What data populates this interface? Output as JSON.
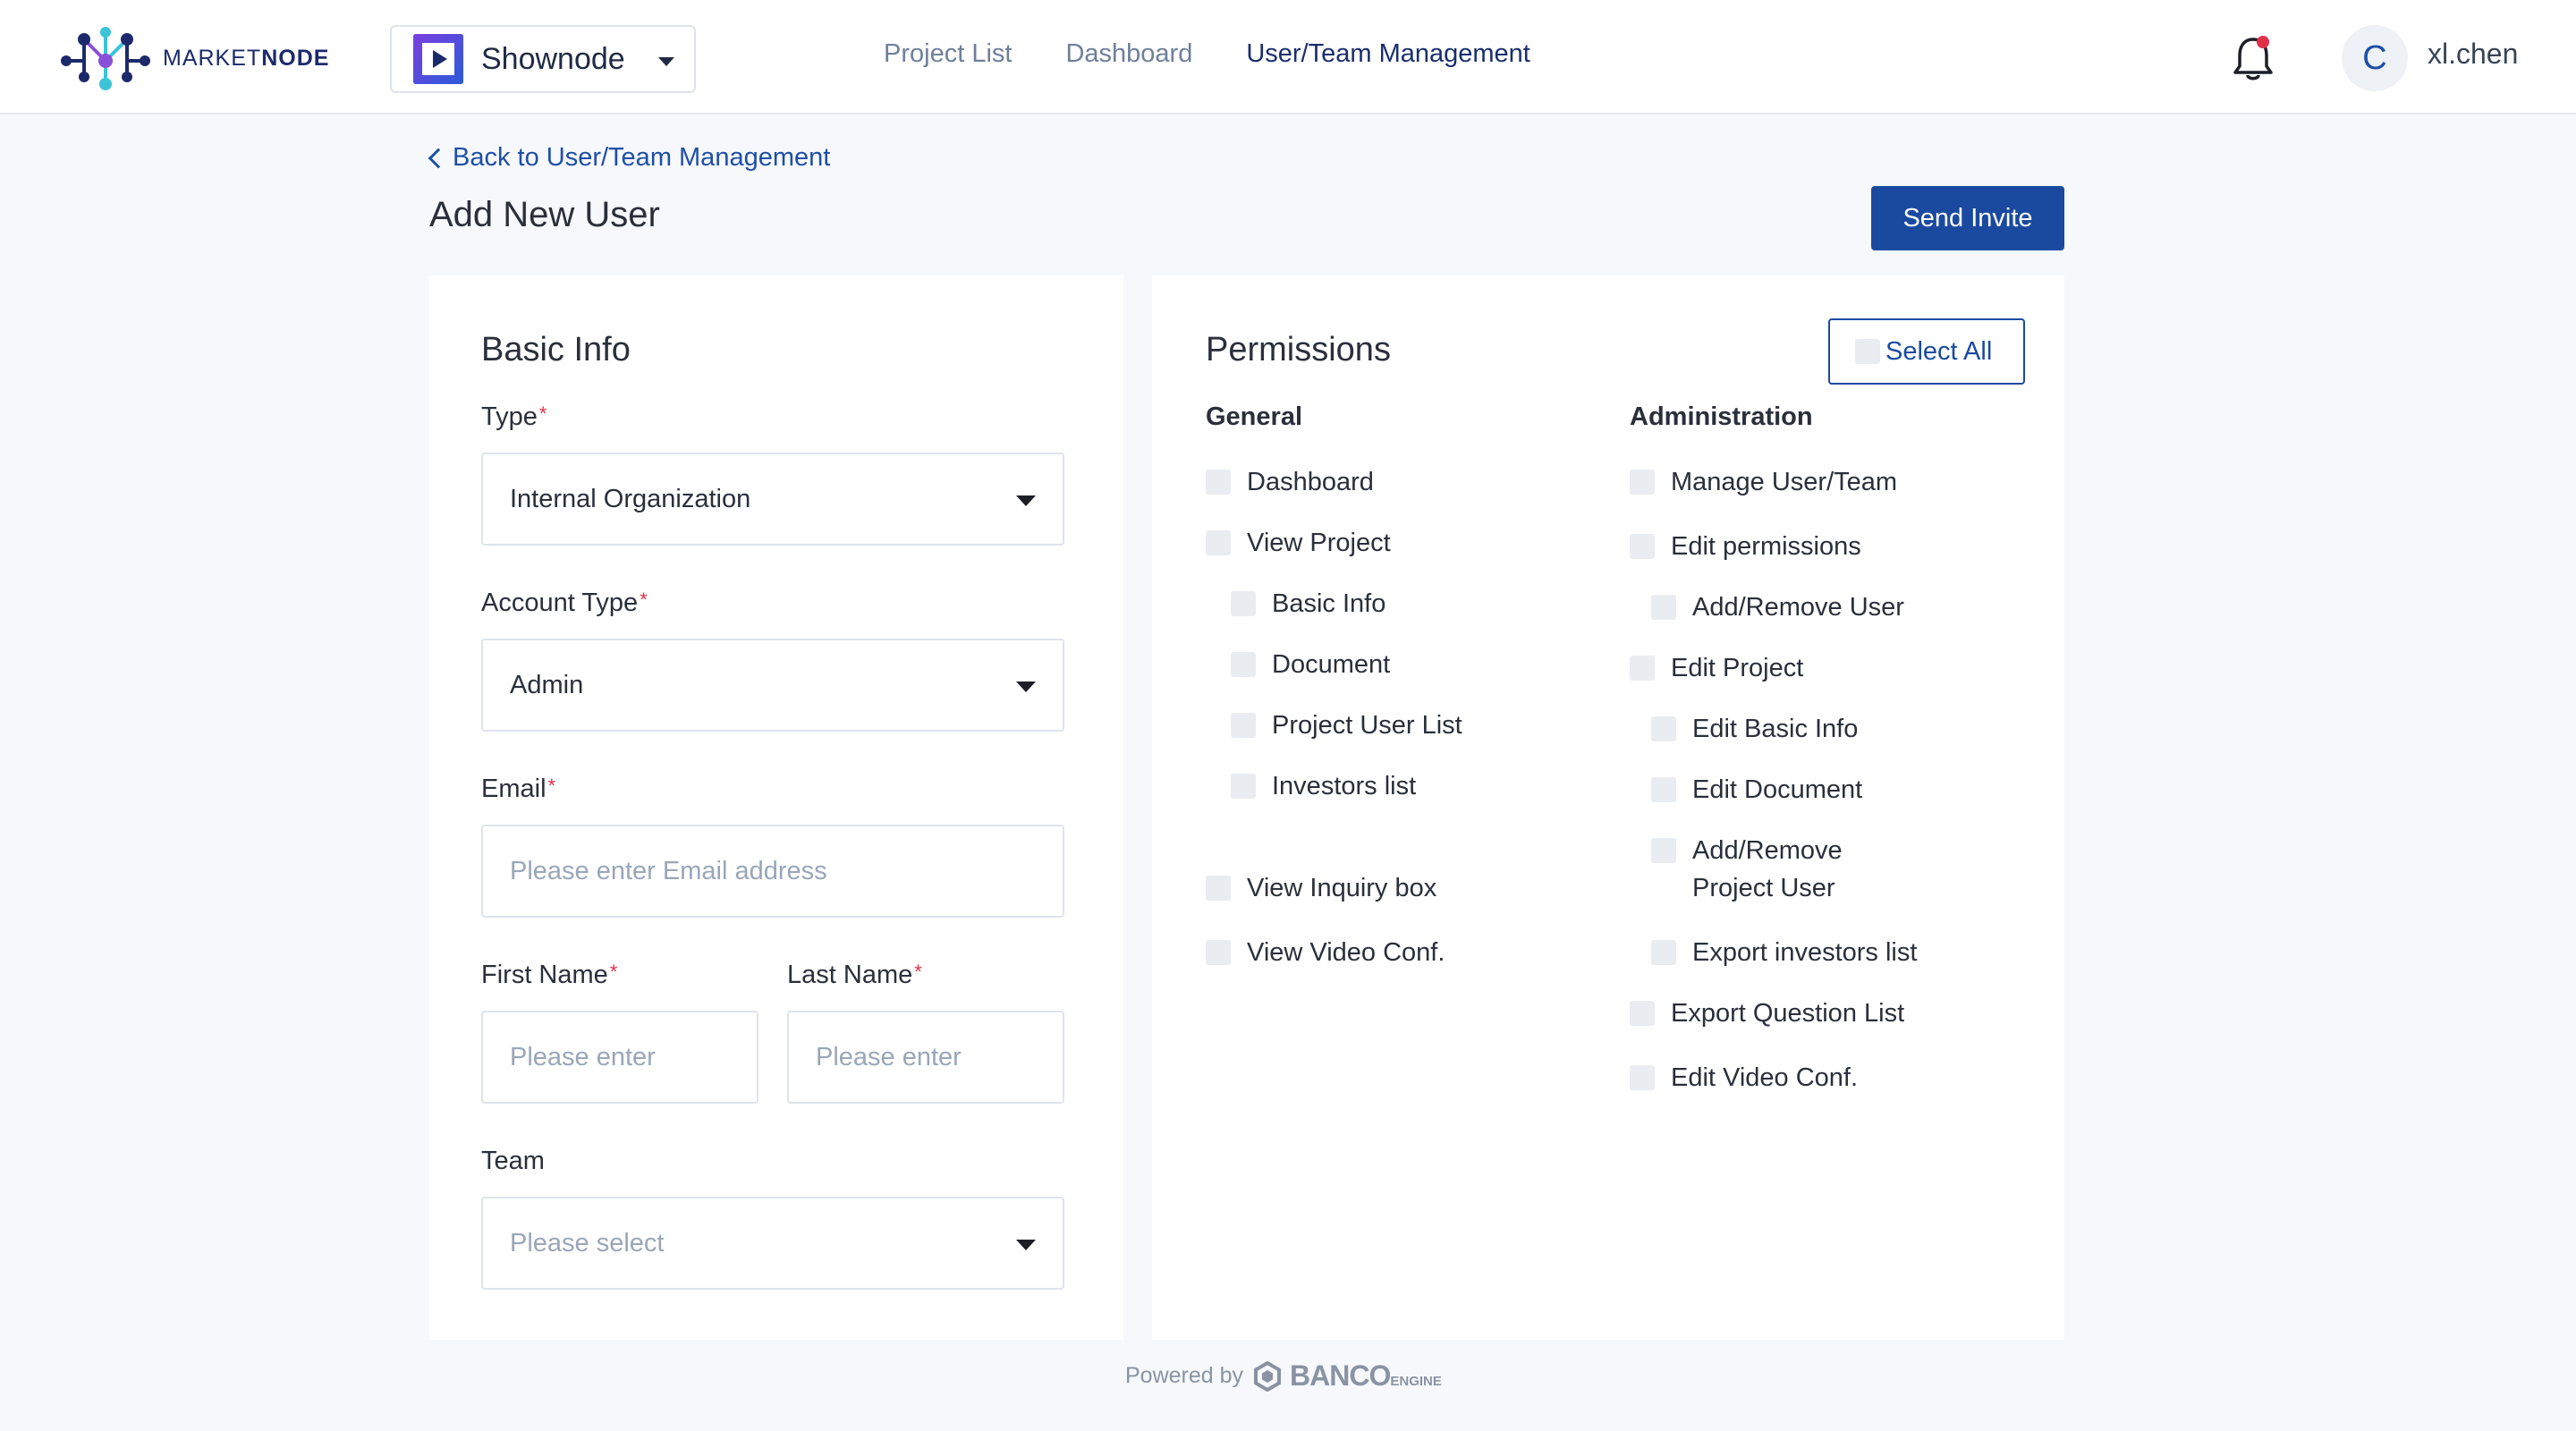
{
  "header": {
    "logo": {
      "part1": "MARKET",
      "part2": "NODE"
    },
    "app_switcher": {
      "name": "Shownode"
    },
    "nav": [
      "Project List",
      "Dashboard",
      "User/Team Management"
    ],
    "active_nav": "User/Team Management",
    "avatar_initial": "C",
    "username": "xl.chen"
  },
  "page": {
    "back_link": "Back to User/Team Management",
    "title": "Add New User",
    "send_invite": "Send Invite"
  },
  "basic_info": {
    "title": "Basic Info",
    "type": {
      "label": "Type",
      "required": "*",
      "value": "Internal Organization"
    },
    "account_type": {
      "label": "Account Type",
      "required": "*",
      "value": "Admin"
    },
    "email": {
      "label": "Email",
      "required": "*",
      "placeholder": "Please enter Email address"
    },
    "first_name": {
      "label": "First Name",
      "required": "*",
      "placeholder": "Please enter"
    },
    "last_name": {
      "label": "Last Name",
      "required": "*",
      "placeholder": "Please enter"
    },
    "team": {
      "label": "Team",
      "placeholder": "Please select"
    }
  },
  "permissions": {
    "title": "Permissions",
    "select_all": "Select All",
    "general": {
      "title": "General",
      "items": [
        "Dashboard",
        "View Project",
        "Basic Info",
        "Document",
        "Project User List",
        "Investors list",
        "View Inquiry box",
        "View Video Conf."
      ]
    },
    "administration": {
      "title": "Administration",
      "items": [
        "Manage User/Team",
        "Edit permissions",
        "Add/Remove User",
        "Edit Project",
        "Edit Basic Info",
        "Edit Document",
        "Add/Remove",
        "Project User",
        "Export investors list",
        "Export Question List",
        "Edit Video Conf."
      ]
    }
  },
  "footer": {
    "powered_by": "Powered by",
    "brand": "BANCO",
    "brand_suffix": "ENGINE"
  }
}
